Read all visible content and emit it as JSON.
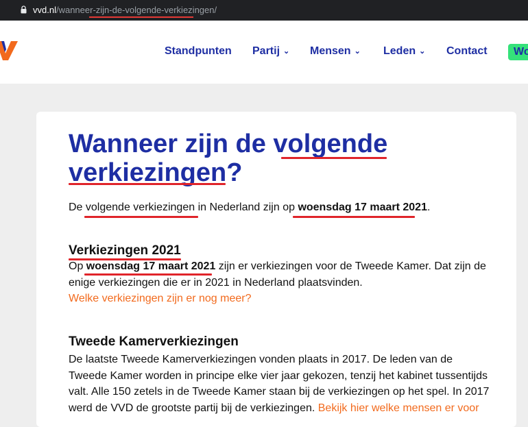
{
  "browser": {
    "url_domain": "vvd.nl",
    "url_path": "/wanneer-zijn-de-volgende-verkiezingen/"
  },
  "nav": {
    "items": [
      {
        "label": "Standpunten",
        "has_dropdown": false
      },
      {
        "label": "Partij",
        "has_dropdown": true
      },
      {
        "label": "Mensen",
        "has_dropdown": true
      },
      {
        "label": "Leden",
        "has_dropdown": true
      },
      {
        "label": "Contact",
        "has_dropdown": false
      }
    ],
    "cta_label": "Wo",
    "colors": {
      "brand": "#1e2ea3",
      "cta": "#35e27a",
      "logo": "#f26a1d"
    }
  },
  "article": {
    "title_line1": "Wanneer zijn de volgende",
    "title_line2": "verkiezingen?",
    "intro": {
      "prefix": "De volgende verkiezingen in Nederland zijn op ",
      "date": "woensdag 17 maart 2021",
      "suffix": "."
    },
    "section1": {
      "heading": "Verkiezingen 2021",
      "line1_prefix": "Op ",
      "line1_date": "woensdag 17 maart 2021",
      "line1_suffix": " zijn er verkiezingen voor de Tweede Kamer. Dat zijn de",
      "line2": "enige verkiezingen die er in 2021 in Nederland plaatsvinden.",
      "link": "Welke verkiezingen zijn er nog meer?"
    },
    "section2": {
      "heading": "Tweede Kamerverkiezingen",
      "line1": "De laatste Tweede Kamerverkiezingen vonden plaats in 2017. De leden van de",
      "line2": "Tweede Kamer worden in principe elke vier jaar gekozen, tenzij het kabinet tussentijds",
      "line3": "valt. Alle 150 zetels in de Tweede Kamer staan bij de verkiezingen op het spel. In 2017",
      "line4_text": "werd de VVD de grootste partij bij de verkiezingen. ",
      "line4_link": "Bekijk hier welke mensen er voor"
    }
  }
}
